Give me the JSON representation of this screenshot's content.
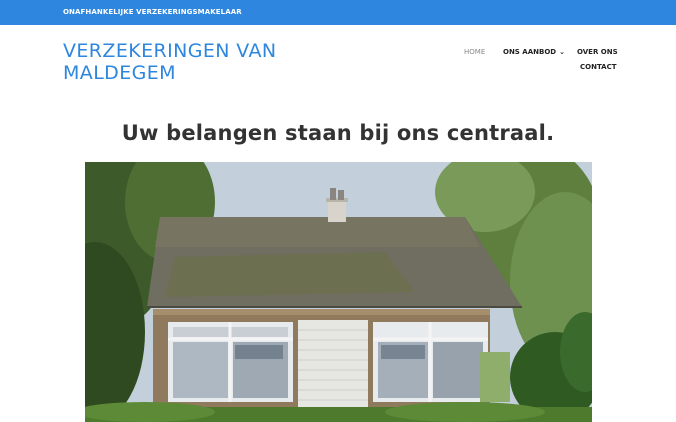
{
  "topbar": {
    "tagline": "ONAFHANKELIJKE VERZEKERINGSMAKELAAR",
    "color": "#2e86de"
  },
  "logo": {
    "line1": "VERZEKERINGEN VAN",
    "line2": "MALDEGEM",
    "color": "#2e86de"
  },
  "nav": {
    "items": [
      {
        "label": "HOME",
        "active": true
      },
      {
        "label": "ONS AANBOD",
        "has_dropdown": true,
        "icon": "chevron-down-icon"
      },
      {
        "label": "OVER ONS"
      },
      {
        "label": "CONTACT"
      }
    ]
  },
  "hero": {
    "headline": "Uw belangen staan bij ons centraal.",
    "image": {
      "subject": "office building photo"
    }
  }
}
